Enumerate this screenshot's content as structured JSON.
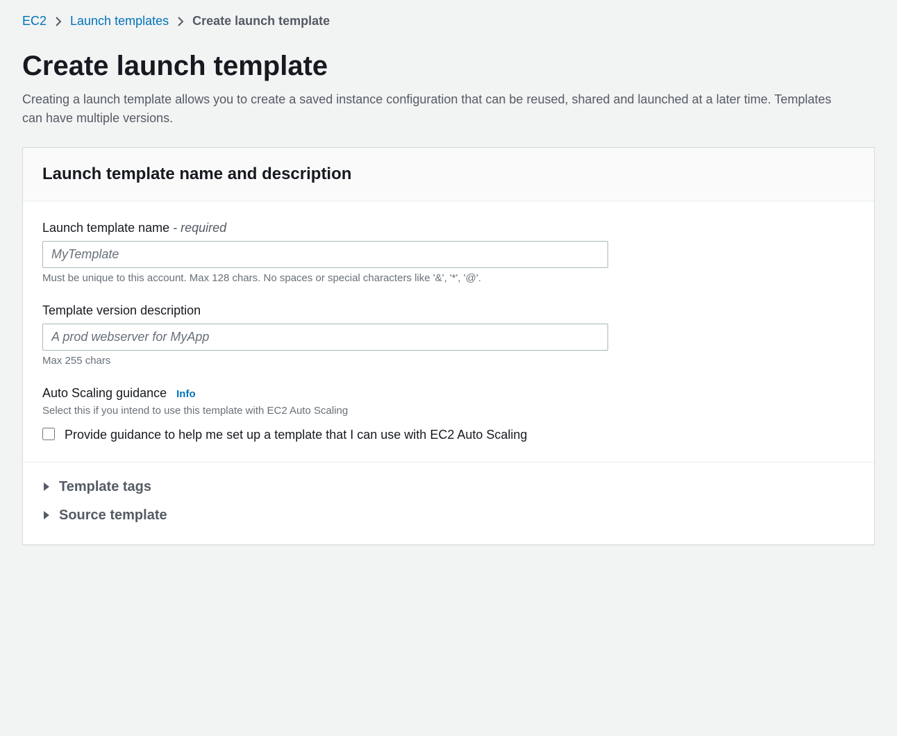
{
  "breadcrumb": {
    "items": [
      {
        "label": "EC2",
        "link": true
      },
      {
        "label": "Launch templates",
        "link": true
      },
      {
        "label": "Create launch template",
        "link": false
      }
    ]
  },
  "page": {
    "title": "Create launch template",
    "description": "Creating a launch template allows you to create a saved instance configuration that can be reused, shared and launched at a later time. Templates can have multiple versions."
  },
  "panel": {
    "heading": "Launch template name and description",
    "name_field": {
      "label": "Launch template name",
      "required_suffix": " - required",
      "placeholder": "MyTemplate",
      "hint": "Must be unique to this account. Max 128 chars. No spaces or special characters like '&', '*', '@'."
    },
    "desc_field": {
      "label": "Template version description",
      "placeholder": "A prod webserver for MyApp",
      "hint": "Max 255 chars"
    },
    "guidance": {
      "label": "Auto Scaling guidance",
      "info": "Info",
      "hint": "Select this if you intend to use this template with EC2 Auto Scaling",
      "checkbox_label": "Provide guidance to help me set up a template that I can use with EC2 Auto Scaling"
    },
    "expanders": [
      {
        "label": "Template tags"
      },
      {
        "label": "Source template"
      }
    ]
  }
}
